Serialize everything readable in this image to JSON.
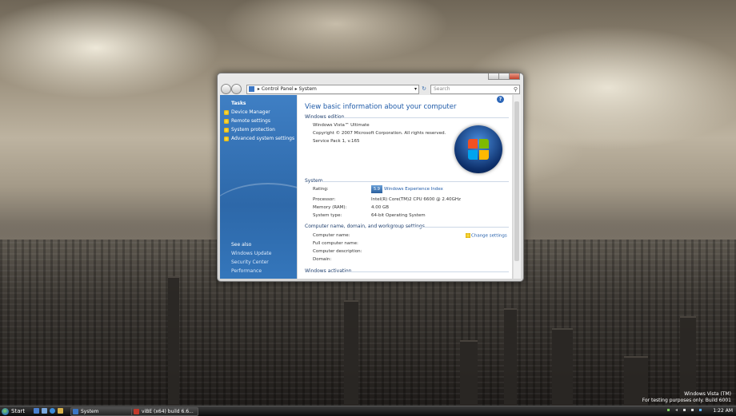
{
  "window": {
    "breadcrumb": [
      "Control Panel",
      "System"
    ],
    "search_placeholder": "Search"
  },
  "tasks": {
    "heading": "Tasks",
    "items": [
      {
        "label": "Device Manager"
      },
      {
        "label": "Remote settings"
      },
      {
        "label": "System protection"
      },
      {
        "label": "Advanced system settings"
      }
    ]
  },
  "see_also": {
    "heading": "See also",
    "items": [
      "Windows Update",
      "Security Center",
      "Performance"
    ]
  },
  "main": {
    "title": "View basic information about your computer",
    "edition_heading": "Windows edition",
    "edition_name": "Windows Vista™ Ultimate",
    "copyright": "Copyright © 2007 Microsoft Corporation.  All rights reserved.",
    "service_pack": "Service Pack 1, v.165",
    "system_heading": "System",
    "rows": [
      {
        "label": "Rating:",
        "value": "Windows Experience Index"
      },
      {
        "label": "Processor:",
        "value": "Intel(R) Core(TM)2 CPU        6600  @ 2.40GHz"
      },
      {
        "label": "Memory (RAM):",
        "value": "4.00 GB"
      },
      {
        "label": "System type:",
        "value": "64-bit Operating System"
      }
    ],
    "computer_heading": "Computer name, domain, and workgroup settings",
    "computer_rows": [
      "Computer name:",
      "Full computer name:",
      "Computer description:",
      "Domain:"
    ],
    "change_settings": "Change settings",
    "activation_heading": "Windows activation",
    "rating_badge": "5.9"
  },
  "watermark": {
    "line1": "Windows Vista (TM)",
    "line2": "For testing purposes only. Build 6001"
  },
  "taskbar": {
    "start_label": "Start",
    "buttons": [
      "System",
      "viBE (x64) build 6.6..."
    ],
    "clock": "1:22 AM"
  },
  "colors": {
    "accent": "#1e5aa8",
    "sidebar": "#2d68a9"
  }
}
